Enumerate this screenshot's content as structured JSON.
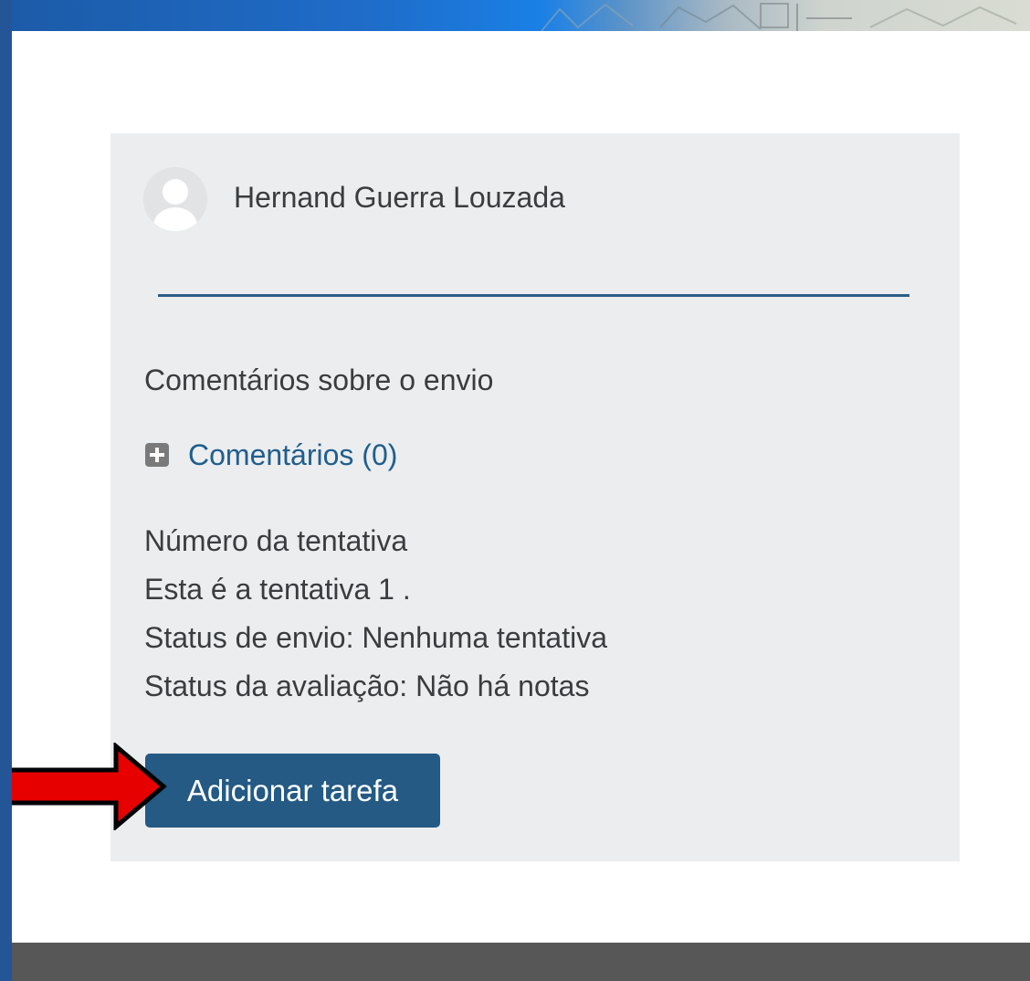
{
  "user": {
    "name": "Hernand Guerra Louzada"
  },
  "feedback": {
    "section_title": "Comentários sobre o envio",
    "comments_link": "Comentários (0)"
  },
  "attempt": {
    "lines": [
      "Número da tentativa",
      "Esta é a tentativa 1 .",
      "Status de envio: Nenhuma tentativa",
      "Status da avaliação: Não há notas"
    ]
  },
  "actions": {
    "add_submission_label": "Adicionar tarefa"
  },
  "icons": {
    "avatar": "user-avatar-icon",
    "expand": "plus-square-icon",
    "pointer": "red-arrow-icon"
  },
  "colors": {
    "primary_button": "#245a84",
    "link": "#205e8d",
    "divider": "#2c5d86",
    "card_background": "#ebedef",
    "footer": "#575757",
    "arrow": "#e60000"
  }
}
